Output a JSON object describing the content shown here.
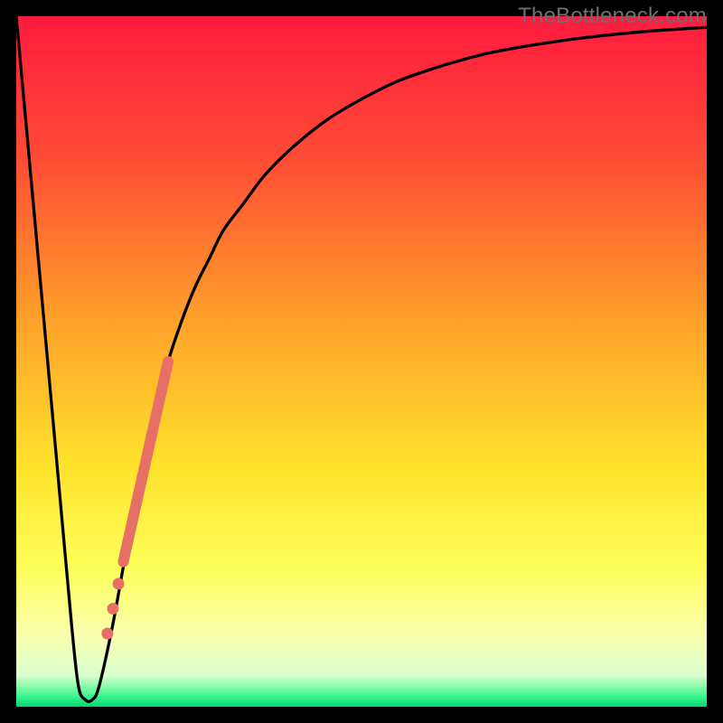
{
  "watermark": "TheBottleneck.com",
  "colors": {
    "frame": "#000000",
    "gradient_stops": [
      {
        "offset": 0.0,
        "color": "#ff1a3f"
      },
      {
        "offset": 0.2,
        "color": "#ff4a35"
      },
      {
        "offset": 0.45,
        "color": "#ffa429"
      },
      {
        "offset": 0.65,
        "color": "#ffe22c"
      },
      {
        "offset": 0.8,
        "color": "#feff5a"
      },
      {
        "offset": 0.9,
        "color": "#f8ffb0"
      },
      {
        "offset": 0.955,
        "color": "#d9ffd0"
      },
      {
        "offset": 0.985,
        "color": "#3bf58a"
      },
      {
        "offset": 1.0,
        "color": "#00d873"
      }
    ],
    "curve": "#000000",
    "markers": "#e77066"
  },
  "chart_data": {
    "type": "line",
    "title": "",
    "xlabel": "",
    "ylabel": "",
    "xlim": [
      0,
      100
    ],
    "ylim": [
      0,
      100
    ],
    "series": [
      {
        "name": "bottleneck-curve",
        "x": [
          0,
          2,
          4,
          6,
          8,
          9,
          10,
          11,
          12,
          14,
          16,
          18,
          20,
          22,
          24,
          26,
          28,
          30,
          33,
          36,
          40,
          45,
          50,
          55,
          60,
          65,
          70,
          80,
          90,
          100
        ],
        "y": [
          100,
          78,
          56,
          34,
          12,
          3,
          1,
          1,
          3,
          12,
          23,
          33,
          42,
          50,
          56,
          61,
          65,
          69,
          73,
          77,
          81,
          85,
          88,
          90.5,
          92.3,
          93.8,
          95,
          96.6,
          97.7,
          98.4
        ]
      }
    ],
    "markers": {
      "name": "highlight-band",
      "segment": {
        "x1": 15.5,
        "y1": 21,
        "x2": 22.0,
        "y2": 50
      },
      "dots": [
        {
          "x": 14.8,
          "y": 17.8
        },
        {
          "x": 14.0,
          "y": 14.2
        },
        {
          "x": 13.2,
          "y": 10.6
        }
      ]
    }
  }
}
